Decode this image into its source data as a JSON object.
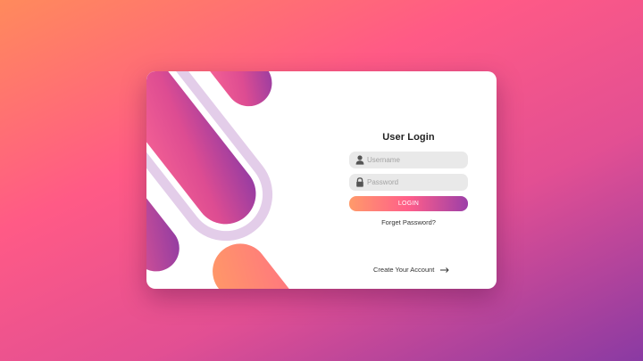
{
  "login": {
    "title": "User Login",
    "username_placeholder": "Username",
    "password_placeholder": "Password",
    "login_label": "LOGIN",
    "forgot_label": "Forget Password?",
    "create_label": "Create Your Account"
  },
  "icons": {
    "username": "user-icon",
    "password": "lock-icon",
    "create": "arrow-right-icon"
  },
  "colors": {
    "accent_start": "#ff9a6a",
    "accent_mid": "#ff5e8a",
    "accent_end": "#9c3fa8",
    "field_bg": "#e9e9e9"
  }
}
